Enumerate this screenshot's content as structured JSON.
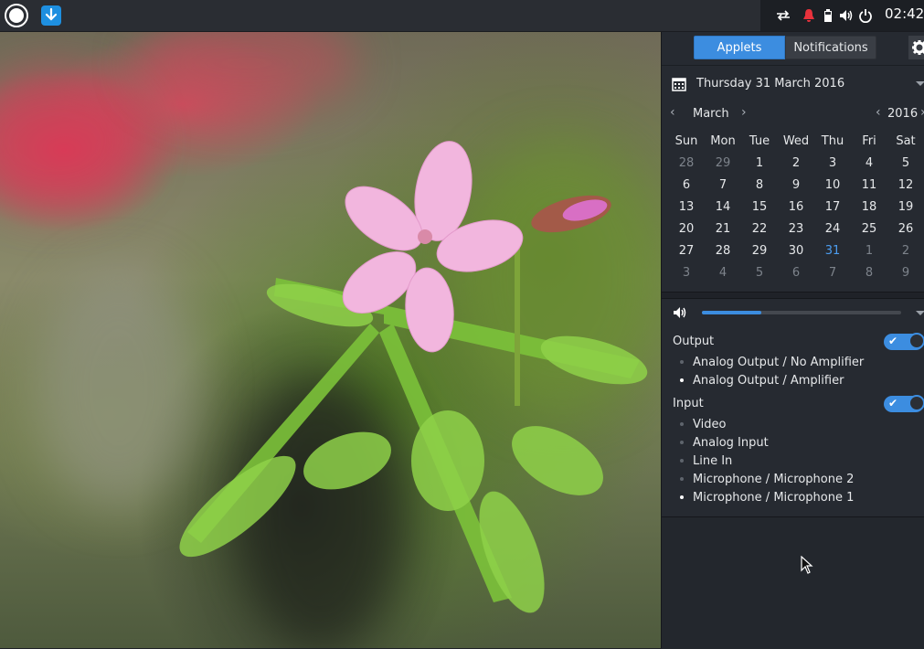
{
  "top_panel": {
    "clock": "02:42",
    "tray_icons": [
      "network-icon",
      "notification-bell-icon",
      "battery-icon",
      "volume-icon",
      "power-icon"
    ]
  },
  "side_panel": {
    "tabs": [
      {
        "label": "Applets",
        "active": true
      },
      {
        "label": "Notifications",
        "active": false
      }
    ],
    "date": {
      "full_date": "Thursday 31 March 2016",
      "month": "March",
      "year": "2016",
      "weekdays": [
        "Sun",
        "Mon",
        "Tue",
        "Wed",
        "Thu",
        "Fri",
        "Sat"
      ],
      "weeks": [
        [
          "28",
          "29",
          "1",
          "2",
          "3",
          "4",
          "5"
        ],
        [
          "6",
          "7",
          "8",
          "9",
          "10",
          "11",
          "12"
        ],
        [
          "13",
          "14",
          "15",
          "16",
          "17",
          "18",
          "19"
        ],
        [
          "20",
          "21",
          "22",
          "23",
          "24",
          "25",
          "26"
        ],
        [
          "27",
          "28",
          "29",
          "30",
          "31",
          "1",
          "2"
        ],
        [
          "3",
          "4",
          "5",
          "6",
          "7",
          "8",
          "9"
        ]
      ]
    },
    "volume": {
      "level": 0.3,
      "output": {
        "title": "Output",
        "enabled": true,
        "devices": [
          {
            "label": "Analog Output / No Amplifier",
            "active": false
          },
          {
            "label": "Analog Output / Amplifier",
            "active": true
          }
        ]
      },
      "input": {
        "title": "Input",
        "enabled": true,
        "devices": [
          {
            "label": "Video",
            "active": false
          },
          {
            "label": "Analog Input",
            "active": false
          },
          {
            "label": "Line In",
            "active": false
          },
          {
            "label": "Microphone / Microphone 2",
            "active": false
          },
          {
            "label": "Microphone / Microphone 1",
            "active": true
          }
        ]
      }
    }
  },
  "colors": {
    "accent": "#3c8de0",
    "today": "#4c9df0",
    "notification_red": "#e8323c"
  }
}
